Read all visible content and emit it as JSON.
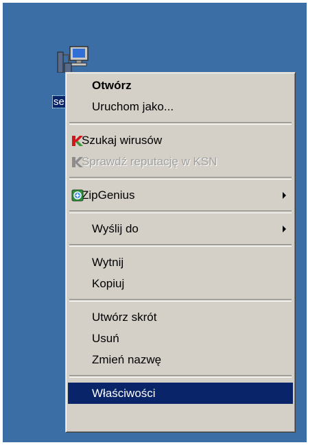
{
  "desktop": {
    "icon": {
      "name": "network-computer-icon",
      "label": "se"
    }
  },
  "context_menu": {
    "items": [
      {
        "label": "Otwórz",
        "style": "default"
      },
      {
        "label": "Uruchom jako..."
      },
      {
        "label": "Szukaj wirusów",
        "icon": "kaspersky-red-icon"
      },
      {
        "label": "Sprawdź reputację w KSN",
        "icon": "kaspersky-gray-icon",
        "state": "disabled"
      },
      {
        "label": "ZipGenius",
        "icon": "zipgenius-icon",
        "submenu": true
      },
      {
        "label": "Wyślij do",
        "submenu": true
      },
      {
        "label": "Wytnij"
      },
      {
        "label": "Kopiuj"
      },
      {
        "label": "Utwórz skrót"
      },
      {
        "label": "Usuń"
      },
      {
        "label": "Zmień nazwę"
      },
      {
        "label": "Właściwości",
        "state": "selected"
      }
    ]
  },
  "colors": {
    "desktop_background": "#3a6ea5",
    "menu_background": "#d4d0c8",
    "selection": "#0a246a",
    "disabled_text": "#a0a0a0"
  }
}
